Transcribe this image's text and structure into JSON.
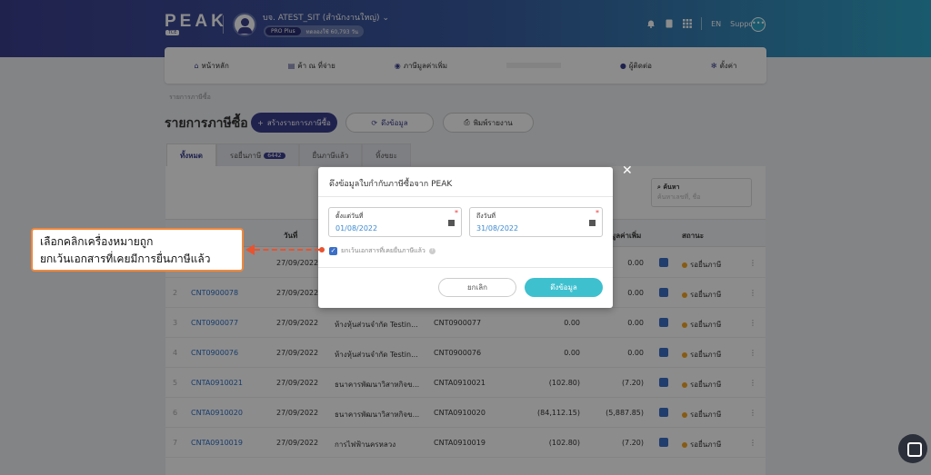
{
  "header": {
    "logo": "PEAK",
    "logo_sub": "TCE",
    "company": "บจ. ATEST_SIT (สำนักงานใหญ่)",
    "plan_badge": "PRO Plus",
    "plan_info": "ทดลองใช้ 60,793 วัน",
    "lang": "EN",
    "support": "Support",
    "more_label": "•••"
  },
  "nav": {
    "items": [
      {
        "label": "หน้าหลัก"
      },
      {
        "label": "ค้า ณ ที่จ่าย"
      },
      {
        "label": "ภาษีมูลค่าเพิ่ม"
      },
      {
        "label": "ผู้ติดต่อ"
      },
      {
        "label": "ตั้งค่า"
      }
    ]
  },
  "breadcrumb": "รายการภาษีซื้อ",
  "page": {
    "title": "รายการภาษีซื้อ",
    "create_button": "สร้างรายการภาษีซื้อ",
    "pull_button": "ดึงข้อมูล",
    "print_button": "พิมพ์รายงาน"
  },
  "tabs": [
    {
      "label": "ทั้งหมด"
    },
    {
      "label": "รอยื่นภาษี",
      "count": "6442"
    },
    {
      "label": "ยื่นภาษีแล้ว"
    },
    {
      "label": "ทิ้งขยะ"
    }
  ],
  "search": {
    "label": "ค้นหา",
    "placeholder": "ค้นหาเลขที่, ชื่อ"
  },
  "table": {
    "headers": {
      "date": "วันที่",
      "vat": "มูลค่าเพิ่ม",
      "status": "สถานะ"
    },
    "rows": [
      {
        "idx": "1",
        "doc": "",
        "date": "27/09/2022",
        "party": "",
        "ref": "",
        "amount": "",
        "vat": "0.00",
        "status": "รอยื่นภาษี"
      },
      {
        "idx": "2",
        "doc": "CNT0900078",
        "date": "27/09/2022",
        "party": "",
        "ref": "",
        "amount": "",
        "vat": "0.00",
        "status": "รอยื่นภาษี"
      },
      {
        "idx": "3",
        "doc": "CNT0900077",
        "date": "27/09/2022",
        "party": "ห้างหุ้นส่วนจำกัด Testin...",
        "ref": "CNT0900077",
        "amount": "0.00",
        "vat": "0.00",
        "status": "รอยื่นภาษี"
      },
      {
        "idx": "4",
        "doc": "CNT0900076",
        "date": "27/09/2022",
        "party": "ห้างหุ้นส่วนจำกัด Testin...",
        "ref": "CNT0900076",
        "amount": "0.00",
        "vat": "0.00",
        "status": "รอยื่นภาษี"
      },
      {
        "idx": "5",
        "doc": "CNTA0910021",
        "date": "27/09/2022",
        "party": "ธนาคารพัฒนาวิสาหกิจข...",
        "ref": "CNTA0910021",
        "amount": "(102.80)",
        "vat": "(7.20)",
        "status": "รอยื่นภาษี"
      },
      {
        "idx": "6",
        "doc": "CNTA0910020",
        "date": "27/09/2022",
        "party": "ธนาคารพัฒนาวิสาหกิจข...",
        "ref": "CNTA0910020",
        "amount": "(84,112.15)",
        "vat": "(5,887.85)",
        "status": "รอยื่นภาษี"
      },
      {
        "idx": "7",
        "doc": "CNTA0910019",
        "date": "27/09/2022",
        "party": "การไฟฟ้านครหลวง",
        "ref": "CNTA0910019",
        "amount": "(102.80)",
        "vat": "(7.20)",
        "status": "รอยื่นภาษี"
      }
    ]
  },
  "modal": {
    "title": "ดึงข้อมูลใบกำกับภาษีซื้อจาก PEAK",
    "from_label": "ตั้งแต่วันที่",
    "from_value": "01/08/2022",
    "to_label": "ถึงวันที่",
    "to_value": "31/08/2022",
    "required_mark": "*",
    "checkbox_label": "ยกเว้นเอกสารที่เคยยื่นภาษีแล้ว",
    "checkbox_mark": "✓",
    "cancel": "ยกเลิก",
    "confirm": "ดึงข้อมูล",
    "close": "✕"
  },
  "callout": {
    "line1": "เลือกคลิกเครื่องหมายถูก",
    "line2": "ยกเว้นเอกสารที่เคยมีการยื่นภาษีแล้ว"
  },
  "colors": {
    "brand": "#3b3f8f",
    "accent": "#3ec0cf",
    "callout_border": "#f0883c",
    "arrow": "#e8532f"
  }
}
